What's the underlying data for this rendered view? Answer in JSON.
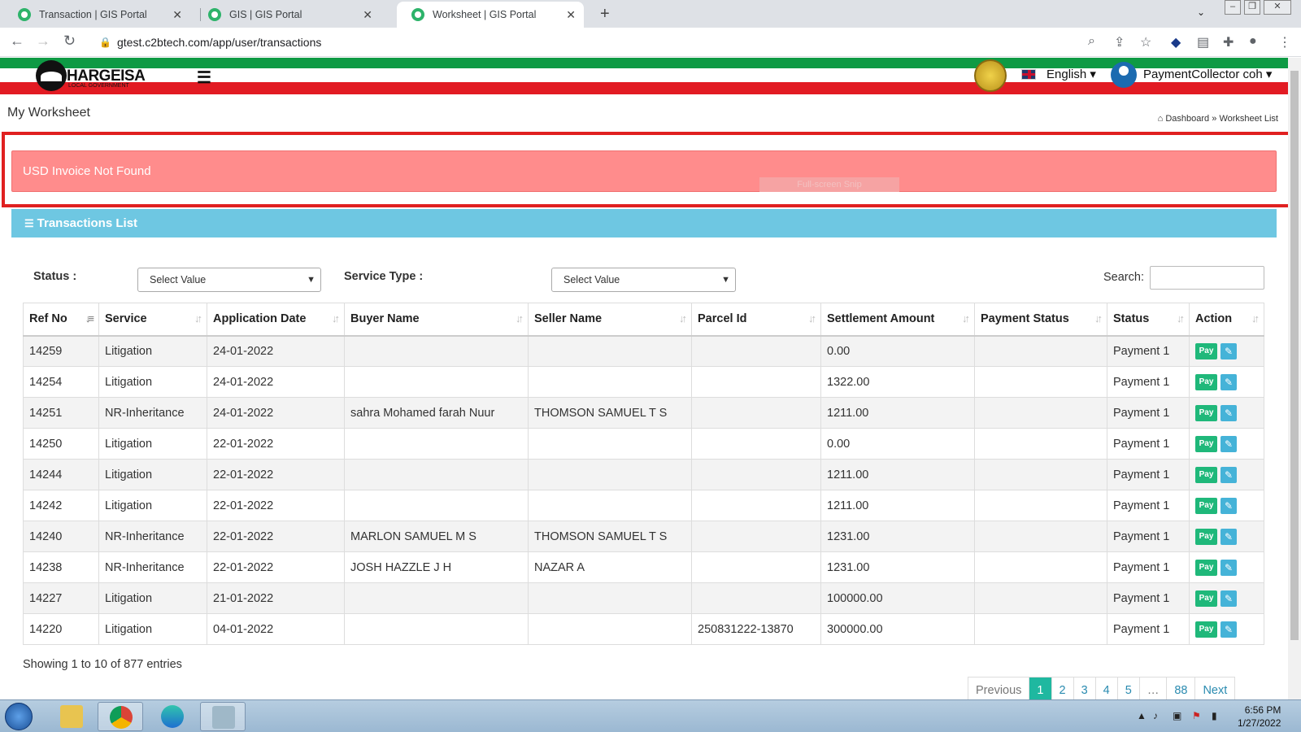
{
  "browser": {
    "tabs": [
      {
        "title": "Transaction | GIS Portal",
        "active": false
      },
      {
        "title": "GIS | GIS Portal",
        "active": false
      },
      {
        "title": "Worksheet | GIS Portal",
        "active": true
      }
    ],
    "url": "gtest.c2btech.com/app/user/transactions"
  },
  "header": {
    "brand": "HARGEISA",
    "brand_sub": "LOCAL GOVERNMENT",
    "language": "English ▾",
    "user": "PaymentCollector coh ▾"
  },
  "page": {
    "title": "My Worksheet",
    "breadcrumb": {
      "home": "Dashboard",
      "sep": "»",
      "current": "Worksheet List"
    }
  },
  "alert": {
    "message": "USD Invoice Not Found",
    "overlay": "Full-screen Snip"
  },
  "panel": {
    "title": "Transactions List"
  },
  "filters": {
    "status_label": "Status :",
    "status_value": "Select Value",
    "service_label": "Service Type :",
    "service_value": "Select Value",
    "search_label": "Search:"
  },
  "table": {
    "columns": [
      "Ref No",
      "Service",
      "Application Date",
      "Buyer Name",
      "Seller Name",
      "Parcel Id",
      "Settlement Amount",
      "Payment Status",
      "Status",
      "Action"
    ],
    "rows": [
      [
        "14259",
        "Litigation",
        "24-01-2022",
        "",
        "",
        "",
        "0.00",
        "",
        "Payment 1"
      ],
      [
        "14254",
        "Litigation",
        "24-01-2022",
        "",
        "",
        "",
        "1322.00",
        "",
        "Payment 1"
      ],
      [
        "14251",
        "NR-Inheritance",
        "24-01-2022",
        "sahra Mohamed farah Nuur",
        "THOMSON SAMUEL T S",
        "",
        "1211.00",
        "",
        "Payment 1"
      ],
      [
        "14250",
        "Litigation",
        "22-01-2022",
        "",
        "",
        "",
        "0.00",
        "",
        "Payment 1"
      ],
      [
        "14244",
        "Litigation",
        "22-01-2022",
        "",
        "",
        "",
        "1211.00",
        "",
        "Payment 1"
      ],
      [
        "14242",
        "Litigation",
        "22-01-2022",
        "",
        "",
        "",
        "1211.00",
        "",
        "Payment 1"
      ],
      [
        "14240",
        "NR-Inheritance",
        "22-01-2022",
        "MARLON SAMUEL M S",
        "THOMSON SAMUEL T S",
        "",
        "1231.00",
        "",
        "Payment 1"
      ],
      [
        "14238",
        "NR-Inheritance",
        "22-01-2022",
        "JOSH HAZZLE J H",
        "NAZAR A",
        "",
        "1231.00",
        "",
        "Payment 1"
      ],
      [
        "14227",
        "Litigation",
        "21-01-2022",
        "",
        "",
        "",
        "100000.00",
        "",
        "Payment 1"
      ],
      [
        "14220",
        "Litigation",
        "04-01-2022",
        "",
        "",
        "250831222-13870",
        "300000.00",
        "",
        "Payment 1"
      ]
    ],
    "pay_label": "Pay",
    "edit_icon": "edit-icon"
  },
  "footer": {
    "info": "Showing 1 to 10 of 877 entries",
    "pages": [
      "Previous",
      "1",
      "2",
      "3",
      "4",
      "5",
      "…",
      "88",
      "Next"
    ],
    "current_page": "1"
  },
  "taskbar": {
    "time": "6:56 PM",
    "date": "1/27/2022"
  },
  "colors": {
    "alert_bg": "#ff8c8c",
    "panel_head": "#6ec7e2",
    "pay_button": "#1fb87a",
    "edit_button": "#45b3d8",
    "flag_green": "#0e9a44",
    "flag_red": "#e21b23",
    "highlight_frame": "#e02020"
  }
}
